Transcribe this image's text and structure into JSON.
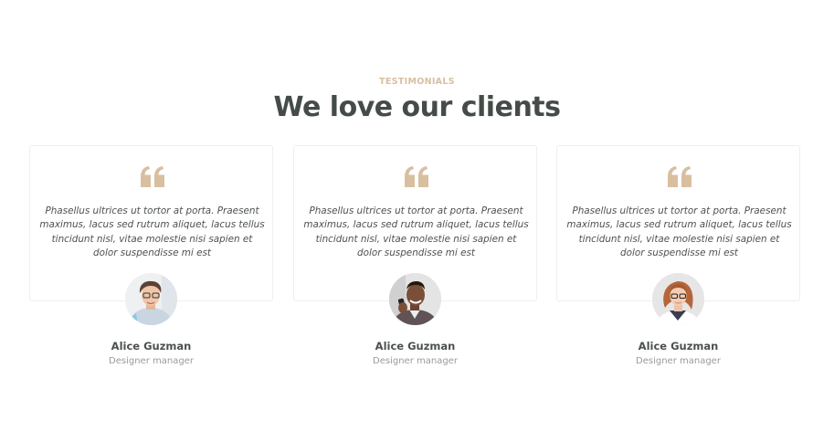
{
  "section": {
    "eyebrow": "TESTIMONIALS",
    "title": "We love our clients"
  },
  "colors": {
    "accent": "#d8bfa0",
    "heading": "#454c48",
    "muted": "#9a9a9a"
  },
  "testimonials": [
    {
      "quote": "Phasellus ultrices ut tortor at porta. Praesent maximus, lacus sed rutrum aliquet, lacus tellus tincidunt nisl, vitae molestie nisi sapien et dolor suspendisse mi est",
      "name": "Alice Guzman",
      "role": "Designer manager",
      "icon": "quote-icon"
    },
    {
      "quote": "Phasellus ultrices ut tortor at porta. Praesent maximus, lacus sed rutrum aliquet, lacus tellus tincidunt nisl, vitae molestie nisi sapien et dolor suspendisse mi est",
      "name": "Alice Guzman",
      "role": "Designer manager",
      "icon": "quote-icon"
    },
    {
      "quote": "Phasellus ultrices ut tortor at porta. Praesent maximus, lacus sed rutrum aliquet, lacus tellus tincidunt nisl, vitae molestie nisi sapien et dolor suspendisse mi est",
      "name": "Alice Guzman",
      "role": "Designer manager",
      "icon": "quote-icon"
    }
  ]
}
